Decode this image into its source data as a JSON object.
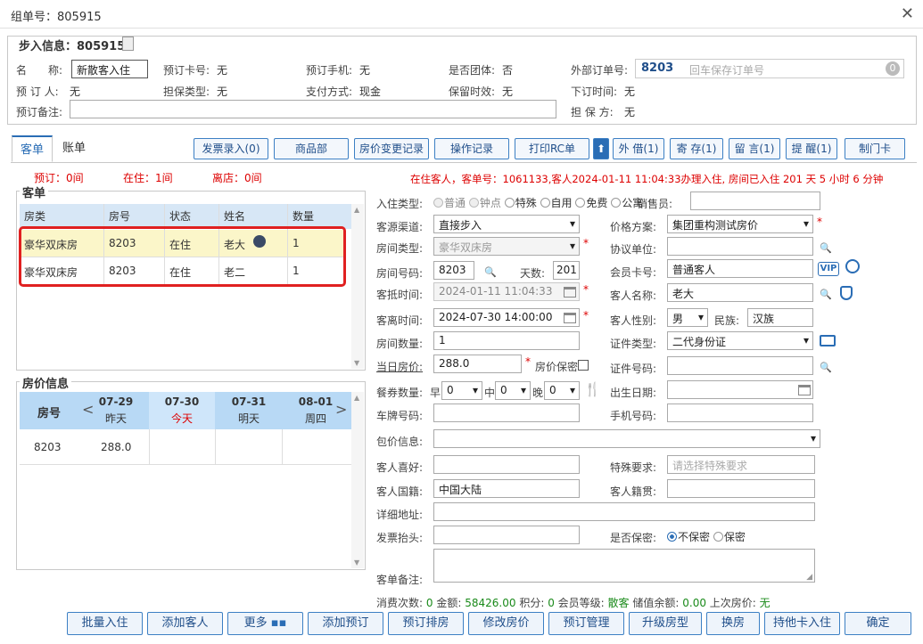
{
  "window": {
    "title": "组单号：805915",
    "close_icon": "close-icon"
  },
  "walkin": {
    "legend": "步入信息：805915",
    "name_label": "名　　称:",
    "name_value": "新散客入住",
    "card_label": "预订卡号:",
    "card_value": "无",
    "phone_label": "预订手机:",
    "phone_value": "无",
    "group_label": "是否团体:",
    "group_value": "否",
    "ext_label": "外部订单号:",
    "ext_value": "8203",
    "ext_placeholder": "回车保存订单号",
    "ext_count": "0",
    "booker_label": "预 订 人:",
    "booker_value": "无",
    "guarantee_label": "担保类型:",
    "guarantee_value": "无",
    "pay_label": "支付方式:",
    "pay_value": "现金",
    "keep_label": "保留时效:",
    "keep_value": "无",
    "ordertime_label": "下订时间:",
    "ordertime_value": "无",
    "remark_label": "预订备注:",
    "guarantor_label": "担 保 方:",
    "guarantor_value": "无"
  },
  "tabs": [
    {
      "label": "客单"
    },
    {
      "label": "账单"
    }
  ],
  "toolbar": {
    "invoice": "发票录入(0)",
    "goods": "商品部",
    "price_log": "房价变更记录",
    "op_log": "操作记录",
    "print": "打印RC单",
    "lend": "外 借(1)",
    "store": "寄 存(1)",
    "msg": "留 言(1)",
    "remind": "提 醒(1)",
    "card": "制门卡"
  },
  "stats": {
    "reserve": "预订：0间",
    "staying": "在住：1间",
    "left": "离店：0间"
  },
  "status_line": "在住客人，客单号：1061133,客人2024-01-11 11:04:33办理入住, 房间已入住 201 天 5 小时 6 分钟",
  "guests_section": "客单",
  "guest_table": {
    "headers": [
      "房类",
      "房号",
      "状态",
      "姓名",
      "数量"
    ],
    "rows": [
      [
        "豪华双床房",
        "8203",
        "在住",
        "老大",
        "1"
      ],
      [
        "豪华双床房",
        "8203",
        "在住",
        "老二",
        "1"
      ]
    ]
  },
  "price_section": "房价信息",
  "price_table": {
    "room_header": "房号",
    "dates": [
      {
        "d": "07-29",
        "w": "昨天"
      },
      {
        "d": "07-30",
        "w": "今天"
      },
      {
        "d": "07-31",
        "w": "明天"
      },
      {
        "d": "08-01",
        "w": "周四"
      }
    ],
    "rows": [
      {
        "room": "8203",
        "price": "288.0"
      }
    ]
  },
  "form": {
    "checkin_type_label": "入住类型:",
    "checkin_types": [
      "普通",
      "钟点",
      "特殊",
      "自用",
      "免费",
      "公寓"
    ],
    "sales_label": "销售员:",
    "source_label": "客源渠道:",
    "source_value": "直接步入",
    "plan_label": "价格方案:",
    "plan_value": "集团重构测试房价",
    "roomtype_label": "房间类型:",
    "roomtype_value": "豪华双床房",
    "agreement_label": "协议单位:",
    "roomno_label": "房间号码:",
    "roomno_value": "8203",
    "days_label": "天数:",
    "days_value": "201",
    "member_label": "会员卡号:",
    "member_value": "普通客人",
    "vip": "VIP",
    "arrive_label": "客抵时间:",
    "arrive_value": "2024-01-11 11:04:33",
    "guestname_label": "客人名称:",
    "guestname_value": "老大",
    "depart_label": "客离时间:",
    "depart_value": "2024-07-30 14:00:00",
    "gender_label": "客人性别:",
    "gender_value": "男",
    "nation_label": "民族:",
    "nation_value": "汉族",
    "roomcount_label": "房间数量:",
    "roomcount_value": "1",
    "idtype_label": "证件类型:",
    "idtype_value": "二代身份证",
    "dayprice_label": "当日房价:",
    "dayprice_value": "288.0",
    "secret_price": "房价保密",
    "idno_label": "证件号码:",
    "meal_label": "餐券数量:",
    "breakfast": "早",
    "lunch": "中",
    "dinner": "晚",
    "meal_b": "0",
    "meal_l": "0",
    "meal_d": "0",
    "birth_label": "出生日期:",
    "plate_label": "车牌号码:",
    "mobile_label": "手机号码:",
    "package_label": "包价信息:",
    "hobby_label": "客人喜好:",
    "special_label": "特殊要求:",
    "special_placeholder": "请选择特殊要求",
    "nationality_label": "客人国籍:",
    "nationality_value": "中国大陆",
    "native_label": "客人籍贯:",
    "address_label": "详细地址:",
    "invoice_label": "发票抬头:",
    "secret_label": "是否保密:",
    "not_secret": "不保密",
    "secret": "保密",
    "remark_label": "客单备注:"
  },
  "summary": {
    "visits_label": "消费次数:",
    "visits": "0",
    "amount_label": "金额:",
    "amount": "58426.00",
    "points_label": "积分:",
    "points": "0",
    "level_label": "会员等级:",
    "level": "散客",
    "balance_label": "储值余额:",
    "balance": "0.00",
    "last_label": "上次房价:",
    "last": "无"
  },
  "bottom": {
    "batch": "批量入住",
    "add_guest": "添加客人",
    "more": "更多",
    "add_reserve": "添加预订",
    "schedule": "预订排房",
    "edit_price": "修改房价",
    "reserve_mgr": "预订管理",
    "upgrade": "升级房型",
    "change": "换房",
    "other_card": "持他卡入住",
    "ok": "确定"
  },
  "colors": {
    "accent": "#3d80c4",
    "highlight": "#fbf6c9",
    "red": "#d00000",
    "green": "#1a8a1a"
  }
}
